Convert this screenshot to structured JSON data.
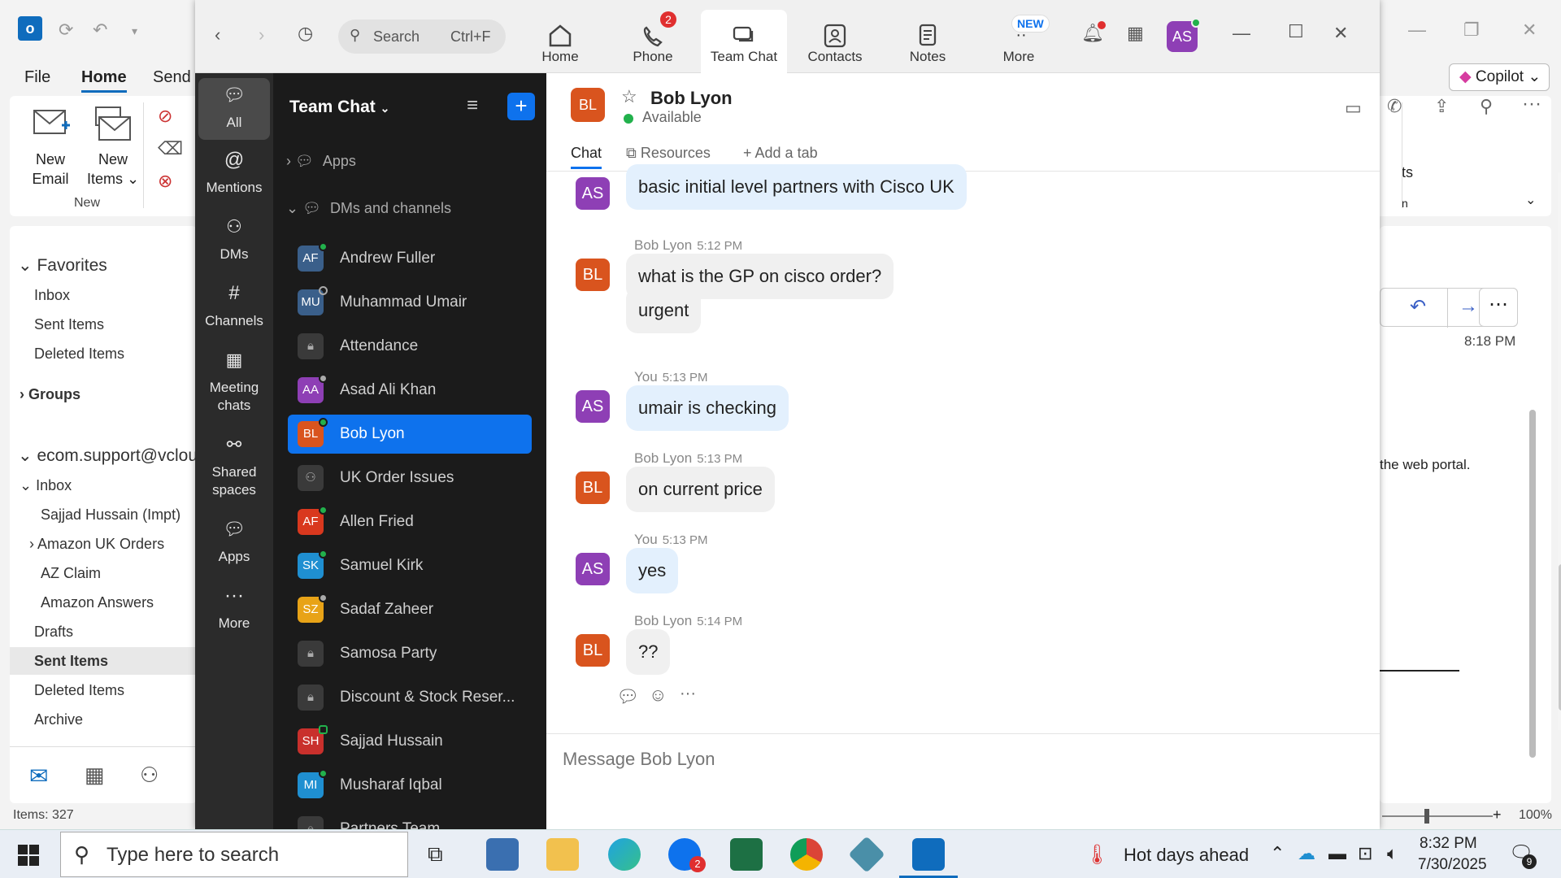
{
  "outlook": {
    "menu": [
      "File",
      "Home",
      "Send"
    ],
    "ribbon": {
      "new_email": "New\nEmail",
      "new_email_l1": "New",
      "new_email_l2": "Email",
      "new_items_l1": "New",
      "new_items_l2": "Items",
      "group_new": "New",
      "copilot": "Copilot"
    },
    "nav": {
      "favorites": "Favorites",
      "fav_items": [
        "Inbox",
        "Sent Items",
        "Deleted Items"
      ],
      "groups": "Groups",
      "account": "ecom.support@vclou",
      "inbox": "Inbox",
      "folders": [
        "Sajjad Hussain (Impt)",
        "Amazon UK Orders",
        "AZ Claim",
        "Amazon Answers"
      ],
      "other": [
        "Drafts",
        "Sent Items",
        "Deleted Items",
        "Archive"
      ]
    },
    "status": {
      "items": "Items: 327",
      "zoom": "100%"
    },
    "reading": {
      "time": "8:18 PM",
      "text": "the web portal.",
      "ts_tail": "ts",
      "n_tail": "n"
    }
  },
  "zoom": {
    "search": {
      "label": "Search",
      "shortcut": "Ctrl+F"
    },
    "tabs": [
      {
        "label": "Home",
        "icon": "home-icon"
      },
      {
        "label": "Phone",
        "icon": "phone-icon",
        "badge": "2"
      },
      {
        "label": "Team Chat",
        "icon": "chat-icon"
      },
      {
        "label": "Contacts",
        "icon": "contacts-icon"
      },
      {
        "label": "Notes",
        "icon": "notes-icon"
      },
      {
        "label": "More",
        "icon": "more-icon",
        "badge": "NEW"
      }
    ],
    "user_initials": "AS",
    "rail": [
      {
        "label": "All",
        "icon": "chat-bubble-icon"
      },
      {
        "label": "Mentions",
        "icon": "at-icon"
      },
      {
        "label": "DMs",
        "icon": "people-icon"
      },
      {
        "label": "Channels",
        "icon": "hash-icon"
      },
      {
        "label": "Meeting chats",
        "icon": "calendar-icon"
      },
      {
        "label": "Shared spaces",
        "icon": "share-icon"
      },
      {
        "label": "Apps",
        "icon": "apps-icon"
      },
      {
        "label": "More",
        "icon": "ellipsis-icon"
      }
    ],
    "list": {
      "title": "Team Chat",
      "apps": "Apps",
      "dms": "DMs and channels",
      "items": [
        {
          "name": "Andrew Fuller",
          "initials": "AF",
          "color": "#3a5f8a",
          "status": "#22b14c"
        },
        {
          "name": "Muhammad Umair",
          "initials": "MU",
          "color": "#3a5f8a",
          "status": "ring"
        },
        {
          "name": "Attendance",
          "lock": true
        },
        {
          "name": "Asad Ali Khan",
          "initials": "AA",
          "color": "#8e3fb5",
          "status": "clock"
        },
        {
          "name": "Bob Lyon",
          "initials": "BL",
          "color": "#d9541e",
          "status": "#22b14c",
          "selected": true
        },
        {
          "name": "UK Order Issues",
          "group": true
        },
        {
          "name": "Allen Fried",
          "initials": "AF",
          "color": "#d9381e",
          "status": "#22b14c"
        },
        {
          "name": "Samuel Kirk",
          "initials": "SK",
          "color": "#1f8fd1",
          "status": "#22b14c"
        },
        {
          "name": "Sadaf Zaheer",
          "initials": "SZ",
          "color": "#e8a317",
          "status": "clock"
        },
        {
          "name": "Samosa Party",
          "lock": true
        },
        {
          "name": "Discount & Stock Reser...",
          "lock": true
        },
        {
          "name": "Sajjad Hussain",
          "initials": "SH",
          "color": "#c9302c",
          "status": "phone"
        },
        {
          "name": "Musharaf Iqbal",
          "initials": "MI",
          "color": "#1f8fd1",
          "status": "#22b14c"
        },
        {
          "name": "Partners Team",
          "lock": true
        }
      ]
    },
    "chat": {
      "contact": "Bob Lyon",
      "initials": "BL",
      "presence": "Available",
      "tabs": [
        "Chat",
        "Resources",
        "Add a tab"
      ],
      "composer_placeholder": "Message Bob Lyon",
      "messages": [
        {
          "who": "AS",
          "text": "basic initial level partners with Cisco UK",
          "me": true
        },
        {
          "who": "BL",
          "sender": "Bob Lyon",
          "time": "5:12 PM",
          "text": "what is the GP on cisco order?"
        },
        {
          "who": "",
          "text": "urgent"
        },
        {
          "who": "AS",
          "sender": "You",
          "time": "5:13 PM",
          "text": "umair is checking",
          "me": true
        },
        {
          "who": "BL",
          "sender": "Bob Lyon",
          "time": "5:13 PM",
          "text": "on current price"
        },
        {
          "who": "AS",
          "sender": "You",
          "time": "5:13 PM",
          "text": "yes",
          "me": true
        },
        {
          "who": "BL",
          "sender": "Bob Lyon",
          "time": "5:14 PM",
          "text": "??"
        }
      ]
    }
  },
  "taskbar": {
    "search_placeholder": "Type here to search",
    "weather": "Hot days ahead",
    "time": "8:32 PM",
    "date": "7/30/2025",
    "notif_count": "9",
    "zoom_badge": "2"
  },
  "colors": {
    "zoom_blue": "#0e72ed",
    "as_purple": "#8e3fb5",
    "bl_orange": "#d9541e",
    "available": "#22b14c"
  }
}
